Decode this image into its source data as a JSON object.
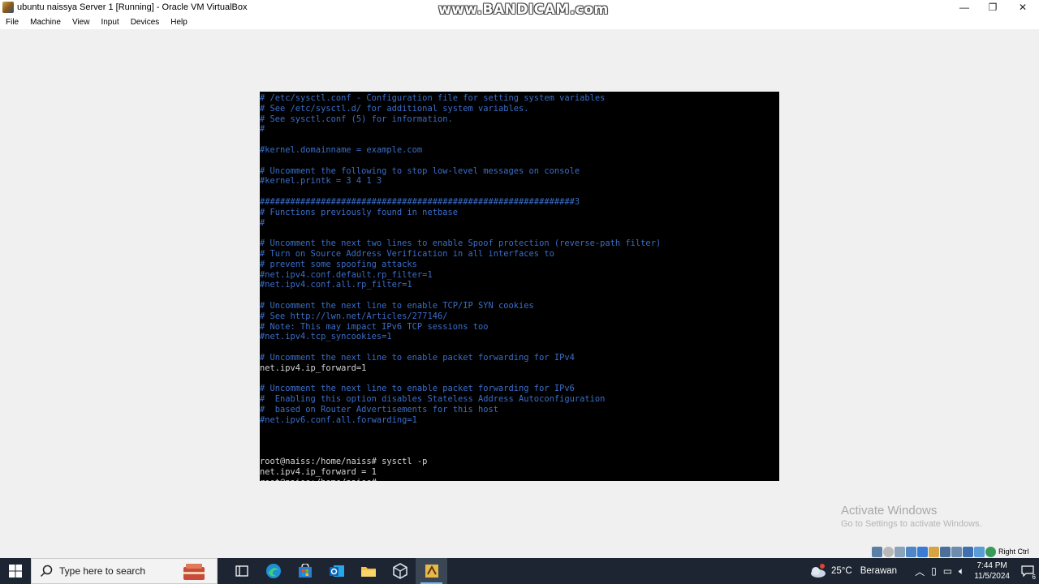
{
  "window": {
    "title": "ubuntu naissya Server 1 [Running] - Oracle VM VirtualBox",
    "watermark": "www.BANDICAM.com",
    "controls": {
      "minimize": "—",
      "restore": "❐",
      "close": "✕"
    }
  },
  "menu": {
    "items": [
      "File",
      "Machine",
      "View",
      "Input",
      "Devices",
      "Help"
    ]
  },
  "terminal": {
    "lines": [
      {
        "text": "# /etc/sysctl.conf - Configuration file for setting system variables",
        "kind": "comment"
      },
      {
        "text": "# See /etc/sysctl.d/ for additional system variables.",
        "kind": "comment"
      },
      {
        "text": "# See sysctl.conf (5) for information.",
        "kind": "comment"
      },
      {
        "text": "#",
        "kind": "comment"
      },
      {
        "text": "",
        "kind": "plain"
      },
      {
        "text": "#kernel.domainname = example.com",
        "kind": "comment"
      },
      {
        "text": "",
        "kind": "plain"
      },
      {
        "text": "# Uncomment the following to stop low-level messages on console",
        "kind": "comment"
      },
      {
        "text": "#kernel.printk = 3 4 1 3",
        "kind": "comment"
      },
      {
        "text": "",
        "kind": "plain"
      },
      {
        "text": "##############################################################3",
        "kind": "comment"
      },
      {
        "text": "# Functions previously found in netbase",
        "kind": "comment"
      },
      {
        "text": "#",
        "kind": "comment"
      },
      {
        "text": "",
        "kind": "plain"
      },
      {
        "text": "# Uncomment the next two lines to enable Spoof protection (reverse-path filter)",
        "kind": "comment"
      },
      {
        "text": "# Turn on Source Address Verification in all interfaces to",
        "kind": "comment"
      },
      {
        "text": "# prevent some spoofing attacks",
        "kind": "comment"
      },
      {
        "text": "#net.ipv4.conf.default.rp_filter=1",
        "kind": "comment"
      },
      {
        "text": "#net.ipv4.conf.all.rp_filter=1",
        "kind": "comment"
      },
      {
        "text": "",
        "kind": "plain"
      },
      {
        "text": "# Uncomment the next line to enable TCP/IP SYN cookies",
        "kind": "comment"
      },
      {
        "text": "# See http://lwn.net/Articles/277146/",
        "kind": "comment"
      },
      {
        "text": "# Note: This may impact IPv6 TCP sessions too",
        "kind": "comment"
      },
      {
        "text": "#net.ipv4.tcp_syncookies=1",
        "kind": "comment"
      },
      {
        "text": "",
        "kind": "plain"
      },
      {
        "text": "# Uncomment the next line to enable packet forwarding for IPv4",
        "kind": "comment"
      },
      {
        "text": "net.ipv4.ip_forward=1",
        "kind": "plain"
      },
      {
        "text": "",
        "kind": "plain"
      },
      {
        "text": "# Uncomment the next line to enable packet forwarding for IPv6",
        "kind": "comment"
      },
      {
        "text": "#  Enabling this option disables Stateless Address Autoconfiguration",
        "kind": "comment"
      },
      {
        "text": "#  based on Router Advertisements for this host",
        "kind": "comment"
      },
      {
        "text": "#net.ipv6.conf.all.forwarding=1",
        "kind": "comment"
      },
      {
        "text": "",
        "kind": "plain"
      },
      {
        "text": "",
        "kind": "plain"
      },
      {
        "text": "",
        "kind": "plain"
      },
      {
        "text": "root@naiss:/home/naiss# sysctl -p",
        "kind": "plain"
      },
      {
        "text": "net.ipv4.ip_forward = 1",
        "kind": "plain"
      },
      {
        "text": "root@naiss:/home/naiss#",
        "kind": "plain"
      }
    ]
  },
  "activation": {
    "title": "Activate Windows",
    "subtitle": "Go to Settings to activate Windows."
  },
  "vbox_status": {
    "host_key": "Right Ctrl",
    "icons": [
      "hard-disk-icon",
      "optical-drive-icon",
      "audio-icon",
      "network-icon",
      "usb-icon",
      "shared-folders-icon",
      "display-icon",
      "video-capture-icon",
      "virtualization-icon",
      "mouse-integration-icon",
      "keyboard-icon"
    ]
  },
  "taskbar": {
    "search_placeholder": "Type here to search",
    "apps": [
      "task-view-icon",
      "edge-icon",
      "store-icon",
      "outlook-icon",
      "file-explorer-icon",
      "virtualbox-manager-icon",
      "virtualbox-vm-icon"
    ],
    "weather": {
      "temp": "25°C",
      "condition": "Berawan"
    },
    "clock": {
      "time": "7:44 PM",
      "date": "11/5/2024"
    },
    "notification_count": "6"
  },
  "colors": {
    "comment": "#3a6ec9",
    "plain": "#d4d4d4",
    "taskbar": "#1c2531"
  }
}
